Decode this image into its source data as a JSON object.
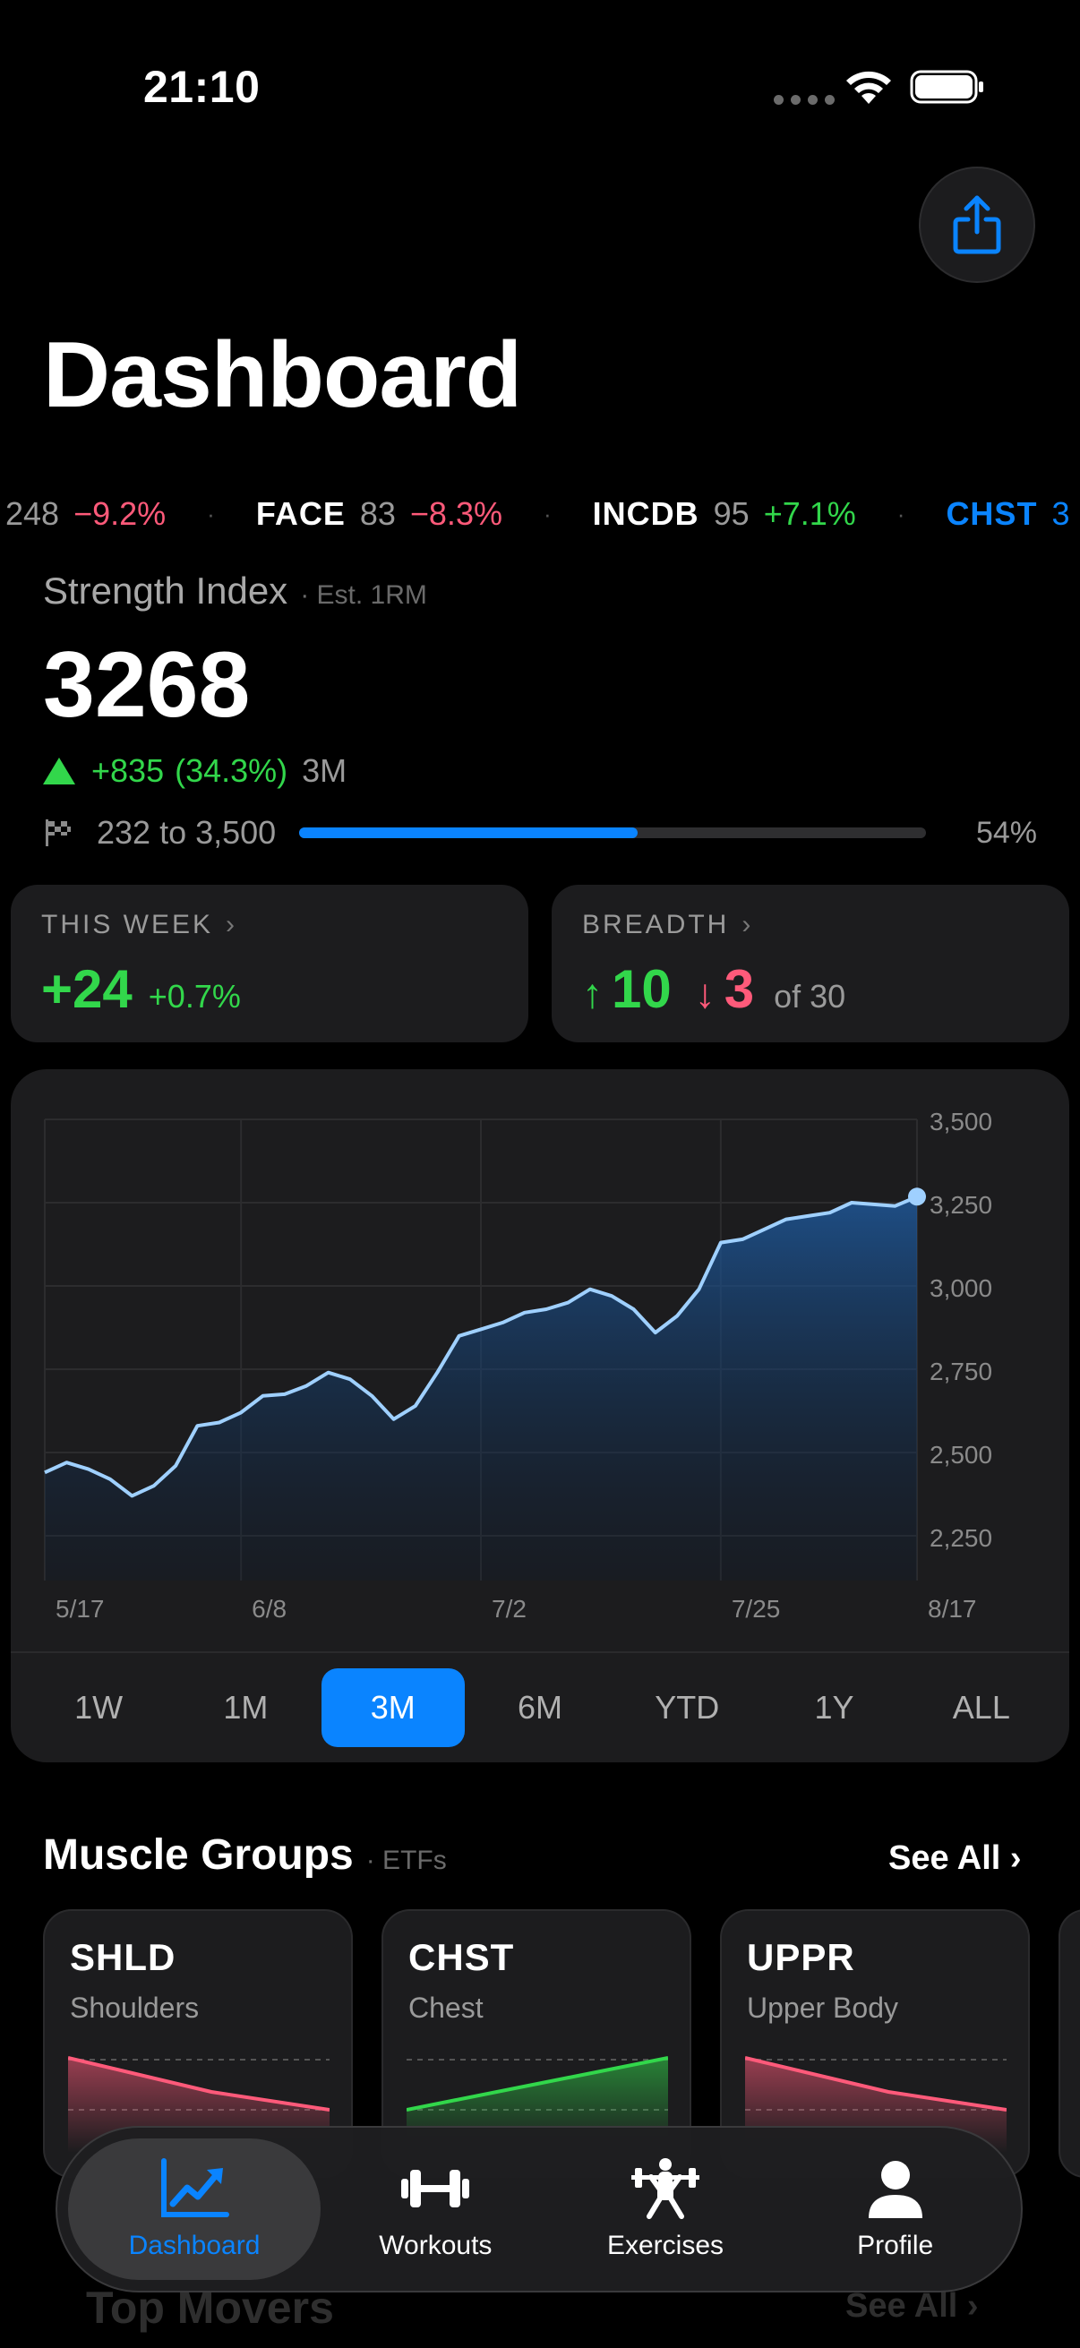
{
  "status": {
    "time": "21:10"
  },
  "header": {
    "title": "Dashboard"
  },
  "ticker": [
    {
      "symbol": "",
      "value": "248",
      "change": "−9.2%",
      "dir": "neg"
    },
    {
      "symbol": "FACE",
      "value": "83",
      "change": "−8.3%",
      "dir": "neg"
    },
    {
      "symbol": "INCDB",
      "value": "95",
      "change": "+7.1%",
      "dir": "pos"
    },
    {
      "symbol": "CHST",
      "value": "3",
      "change": "",
      "dir": "accent"
    }
  ],
  "strength": {
    "label": "Strength Index",
    "sublabel": "· Est. 1RM",
    "value": "3268",
    "change": "+835",
    "change_pct": "(34.3%)",
    "period": "3M",
    "range_text": "232 to 3,500",
    "progress": 0.54,
    "progress_text": "54%"
  },
  "this_week": {
    "label": "THIS WEEK",
    "value": "+24",
    "pct": "+0.7%"
  },
  "breadth": {
    "label": "BREADTH",
    "up": "10",
    "down": "3",
    "of": "of 30"
  },
  "chart_data": {
    "type": "area",
    "x": [
      "5/17",
      "5/20",
      "5/23",
      "5/26",
      "5/29",
      "6/1",
      "6/3",
      "6/5",
      "6/7",
      "6/8",
      "6/11",
      "6/13",
      "6/15",
      "6/17",
      "6/20",
      "6/22",
      "6/24",
      "6/26",
      "6/29",
      "7/1",
      "7/2",
      "7/5",
      "7/7",
      "7/9",
      "7/11",
      "7/14",
      "7/16",
      "7/18",
      "7/20",
      "7/22",
      "7/24",
      "7/25",
      "7/28",
      "7/30",
      "8/1",
      "8/3",
      "8/5",
      "8/8",
      "8/11",
      "8/14",
      "8/17"
    ],
    "values": [
      2440,
      2470,
      2450,
      2420,
      2370,
      2400,
      2460,
      2580,
      2590,
      2620,
      2670,
      2675,
      2700,
      2740,
      2720,
      2670,
      2600,
      2640,
      2740,
      2850,
      2870,
      2890,
      2920,
      2930,
      2950,
      2990,
      2970,
      2930,
      2860,
      2910,
      2990,
      3130,
      3140,
      3170,
      3200,
      3210,
      3220,
      3250,
      3245,
      3240,
      3268
    ],
    "x_ticks": [
      "5/17",
      "6/8",
      "7/2",
      "7/25",
      "8/17"
    ],
    "y_ticks": [
      "3,500",
      "3,250",
      "3,000",
      "2,750",
      "2,500",
      "2,250"
    ],
    "ylim": [
      2150,
      3500
    ],
    "grid": true,
    "color": "#9fd0ff"
  },
  "ranges": [
    "1W",
    "1M",
    "3M",
    "6M",
    "YTD",
    "1Y",
    "ALL"
  ],
  "active_range": "3M",
  "muscle_groups": {
    "title": "Muscle Groups",
    "sub": "· ETFs",
    "see_all": "See All",
    "items": [
      {
        "symbol": "SHLD",
        "name": "Shoulders",
        "trend": "down",
        "color": "#ff5a7a"
      },
      {
        "symbol": "CHST",
        "name": "Chest",
        "trend": "up",
        "color": "#32d74b"
      },
      {
        "symbol": "UPPR",
        "name": "Upper Body",
        "trend": "down",
        "color": "#ff5a7a"
      }
    ]
  },
  "tabs": [
    {
      "label": "Dashboard",
      "icon": "chart-icon",
      "active": true
    },
    {
      "label": "Workouts",
      "icon": "dumbbell-icon",
      "active": false
    },
    {
      "label": "Exercises",
      "icon": "weightlifter-icon",
      "active": false
    },
    {
      "label": "Profile",
      "icon": "person-icon",
      "active": false
    }
  ],
  "top_movers": {
    "title": "Top Movers",
    "see_all": "See All"
  },
  "colors": {
    "accent": "#0a84ff",
    "positive": "#32d74b",
    "negative": "#ff5a7a"
  }
}
